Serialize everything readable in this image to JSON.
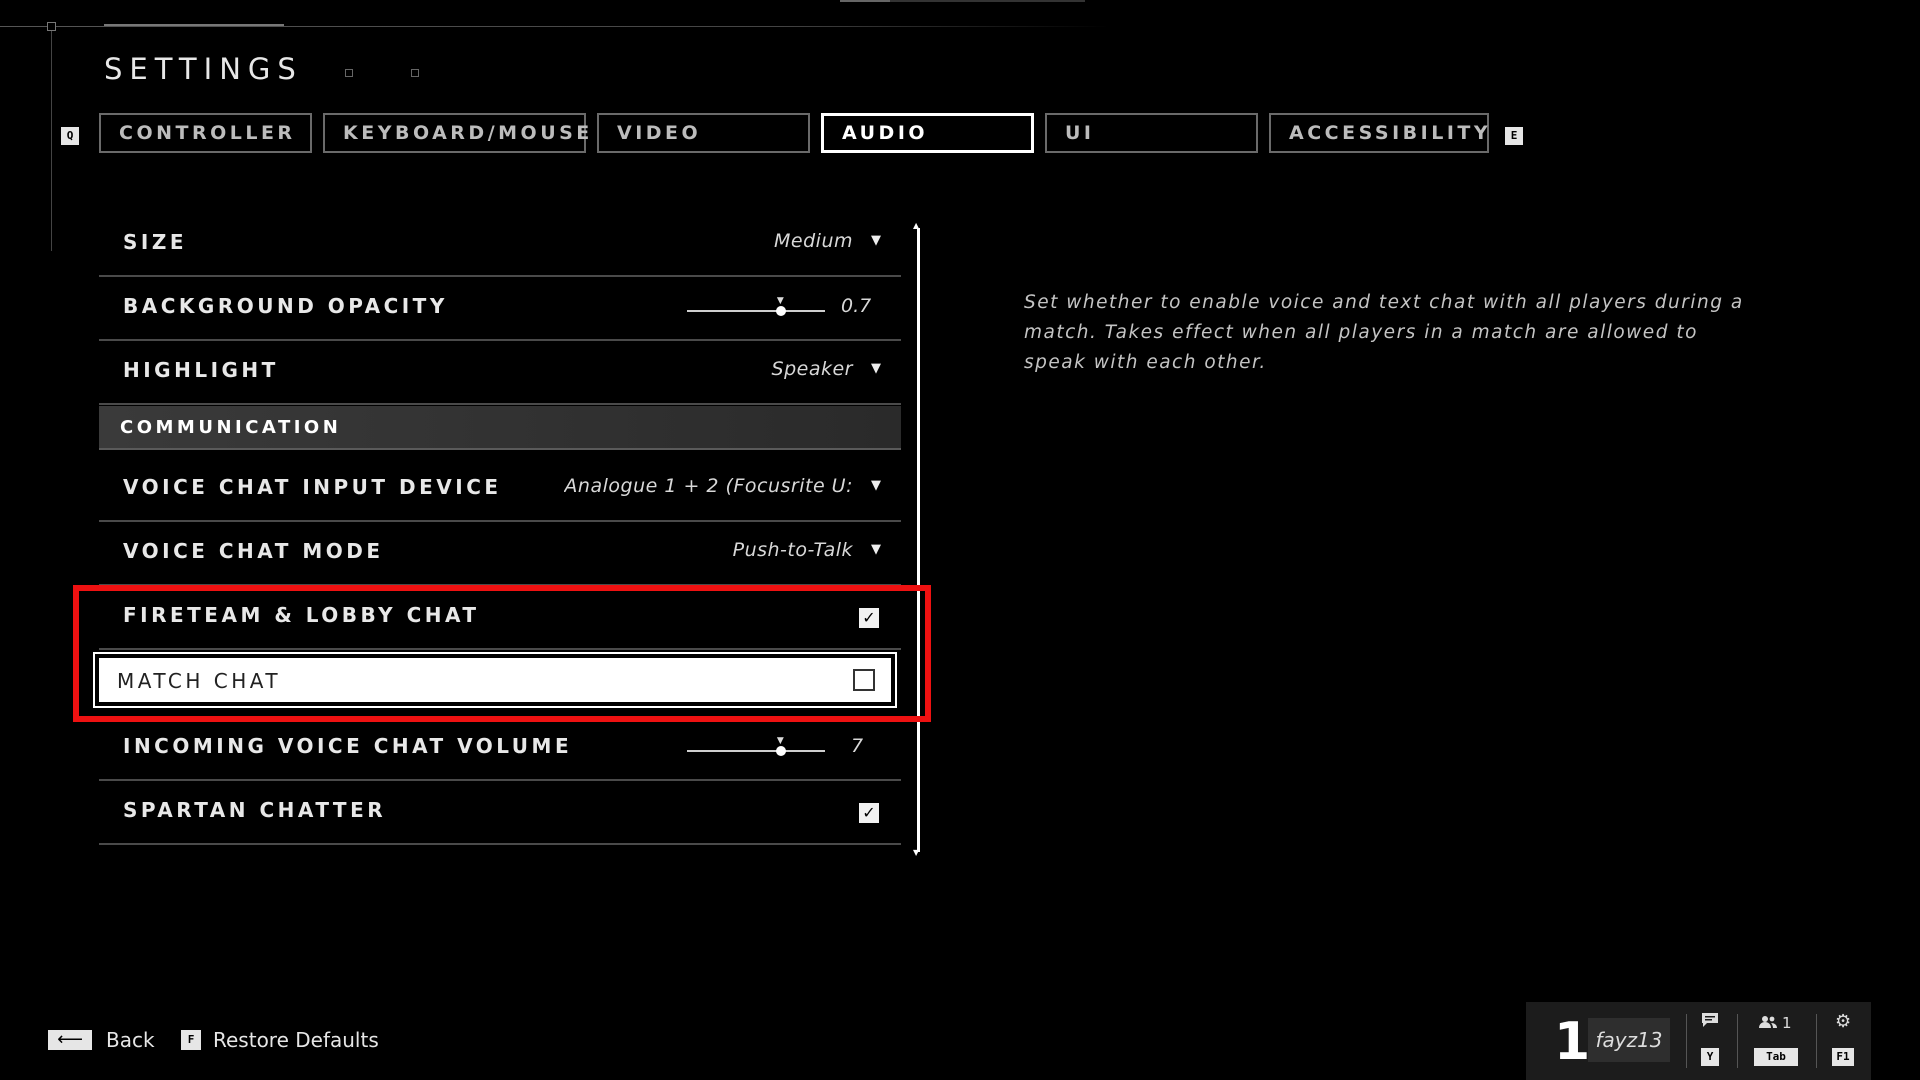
{
  "header": {
    "title": "SETTINGS"
  },
  "tabs": {
    "prev_key": "Q",
    "next_key": "E",
    "items": [
      {
        "label": "CONTROLLER"
      },
      {
        "label": "KEYBOARD/MOUSE"
      },
      {
        "label": "VIDEO"
      },
      {
        "label": "AUDIO",
        "active": true
      },
      {
        "label": "UI"
      },
      {
        "label": "ACCESSIBILITY"
      }
    ]
  },
  "settings": {
    "size": {
      "label": "SIZE",
      "value": "Medium"
    },
    "background_opacity": {
      "label": "BACKGROUND OPACITY",
      "value": "0.7",
      "fraction": 0.68
    },
    "highlight": {
      "label": "HIGHLIGHT",
      "value": "Speaker"
    },
    "section_communication": {
      "label": "COMMUNICATION"
    },
    "voice_chat_input_device": {
      "label": "VOICE CHAT INPUT DEVICE",
      "value": "Analogue 1 + 2 (Focusrite U:"
    },
    "voice_chat_mode": {
      "label": "VOICE CHAT MODE",
      "value": "Push-to-Talk"
    },
    "fireteam_lobby_chat": {
      "label": "FIRETEAM & LOBBY CHAT",
      "checked": true
    },
    "match_chat": {
      "label": "MATCH CHAT",
      "checked": false,
      "selected": true
    },
    "incoming_voice_chat_volume": {
      "label": "INCOMING VOICE CHAT VOLUME",
      "value": "7",
      "fraction": 0.68
    },
    "spartan_chatter": {
      "label": "SPARTAN CHATTER",
      "checked": true
    }
  },
  "description": "Set whether to enable voice and text chat with all players during a match. Takes effect when all players in a match are allowed to speak with each other.",
  "footer": {
    "back_label": "Back",
    "restore_key": "F",
    "restore_label": "Restore Defaults"
  },
  "player_bar": {
    "rank": "1",
    "gamertag": "fayz13",
    "chat_key": "Y",
    "party_count": "1",
    "party_key": "Tab",
    "settings_key": "F1"
  },
  "colors": {
    "accent_highlight": "#ee1111",
    "background": "#000000"
  },
  "icons": [
    "back-arrow-icon",
    "chat-icon",
    "party-icon",
    "gear-icon",
    "checkmark-icon",
    "dropdown-caret-icon"
  ]
}
